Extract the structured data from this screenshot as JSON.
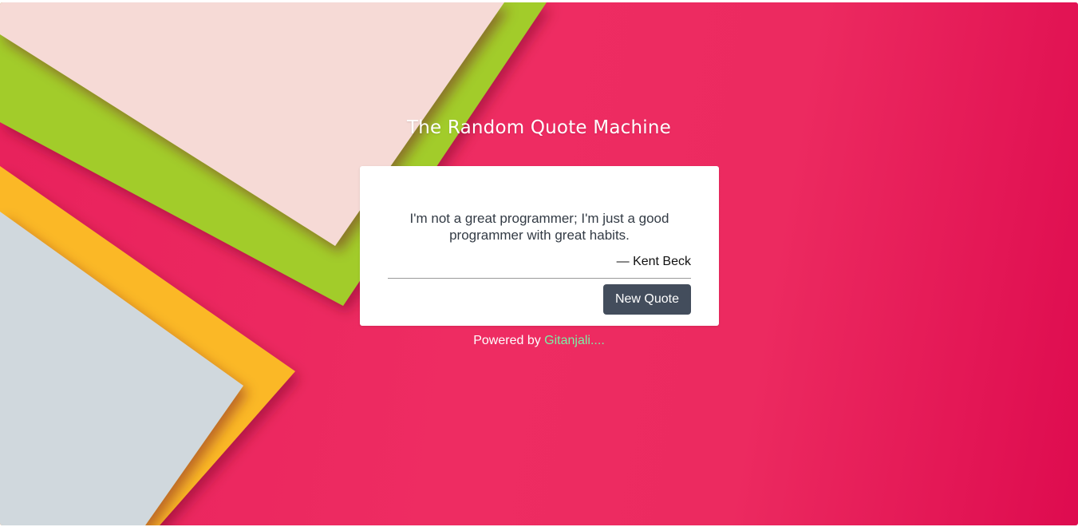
{
  "app": {
    "title": "The Random Quote Machine"
  },
  "quote": {
    "text": "I'm not a great programmer; I'm just a good programmer with great habits.",
    "author": "— Kent Beck"
  },
  "actions": {
    "new_quote_label": "New Quote"
  },
  "footer": {
    "prefix": "Powered by ",
    "link_text": "Gitanjali...."
  },
  "colors": {
    "background_pink": "#e8215c",
    "button": "#434d5c",
    "link": "#7cf0a6",
    "card": "#ffffff"
  }
}
